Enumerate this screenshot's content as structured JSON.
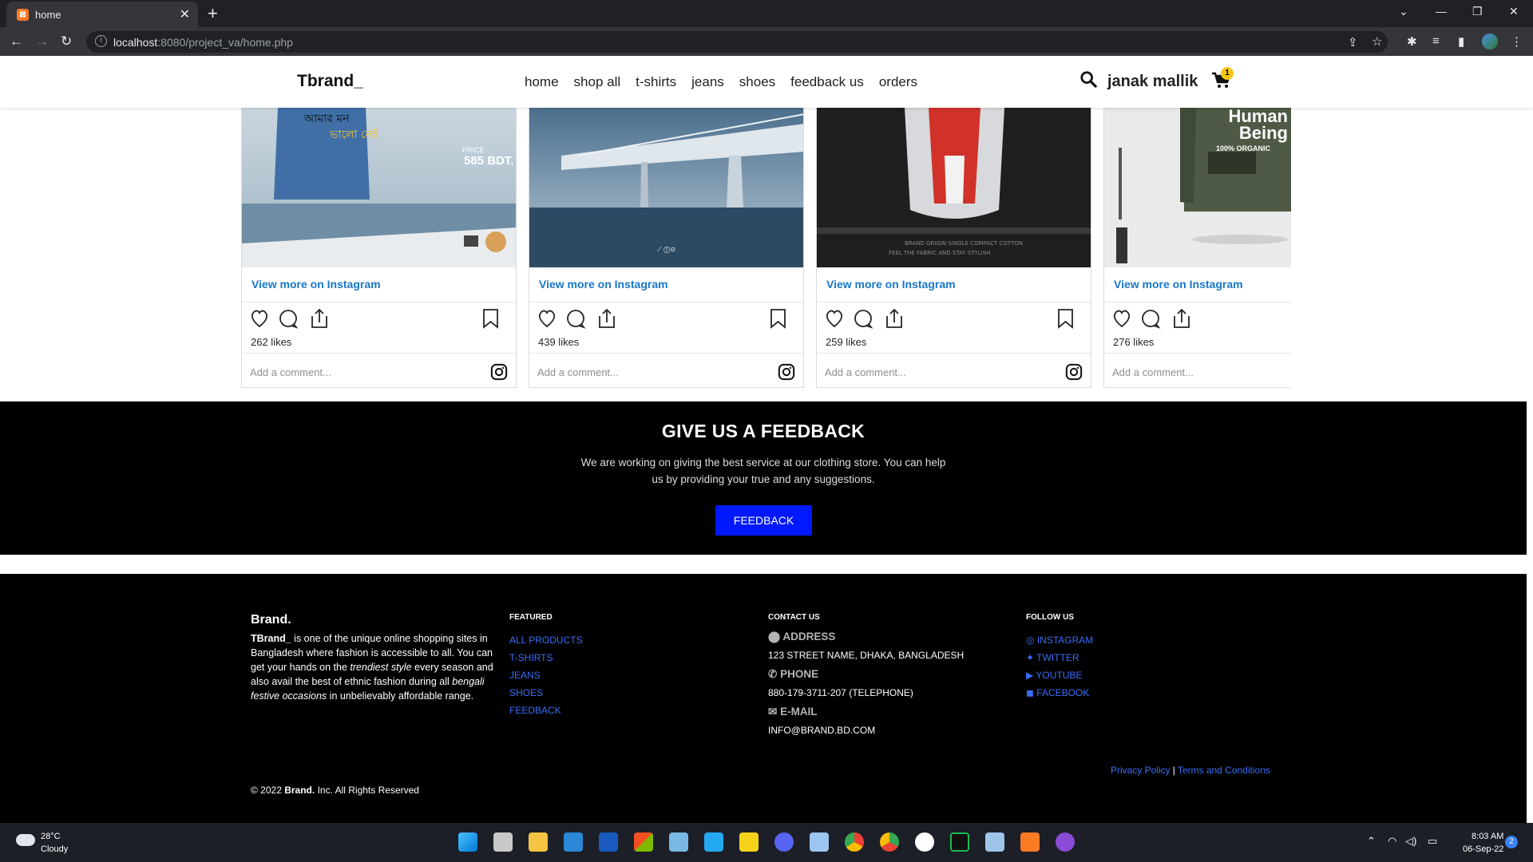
{
  "browser": {
    "tab_title": "home",
    "new_tab": "+",
    "url_host": "localhost",
    "url_rest": ":8080/project_va/home.php"
  },
  "site": {
    "brand": "Tbrand_",
    "nav": [
      "home",
      "shop all",
      "t-shirts",
      "jeans",
      "shoes",
      "feedback us",
      "orders"
    ],
    "user": "janak mallik",
    "cart_count": "1"
  },
  "instagram": {
    "link_label": "View more on Instagram",
    "comment_placeholder": "Add a comment...",
    "posts": [
      {
        "likes": "262 likes",
        "price_label": "PRICE",
        "price": "585 BDT."
      },
      {
        "likes": "439 likes"
      },
      {
        "likes": "259 likes"
      },
      {
        "likes": "276 likes",
        "headline": "Human Being",
        "organic": "100% ORGANIC"
      }
    ]
  },
  "feedback": {
    "title": "GIVE US A FEEDBACK",
    "text": "We are working on giving the best service at our clothing store. You can help us by providing your true and any suggestions.",
    "button": "FEEDBACK"
  },
  "footer": {
    "brand": "Brand.",
    "about_bold": "TBrand_",
    "about_1": " is one of the unique online shopping sites in Bangladesh where fashion is accessible to all. You can get your hands on the ",
    "about_italic1": "trendiest style",
    "about_2": " every season and also avail the best of ethnic fashion during all ",
    "about_italic2": "bengali festive occasions",
    "about_3": " in unbelievably affordable range.",
    "featured_title": "FEATURED",
    "featured": [
      "ALL PRODUCTS",
      "T-SHIRTS",
      "JEANS",
      "SHOES",
      "FEEDBACK"
    ],
    "contact_title": "CONTACT US",
    "address_label": "ADDRESS",
    "address": "123 STREET NAME, DHAKA, BANGLADESH",
    "phone_label": "PHONE",
    "phone": "880-179-3711-207 (TELEPHONE)",
    "email_label": "E-MAIL",
    "email": "INFO@BRAND.BD.COM",
    "follow_title": "FOLLOW US",
    "social": [
      "INSTAGRAM",
      "TWITTER",
      "YOUTUBE",
      "FACEBOOK"
    ],
    "privacy": "Privacy Policy",
    "terms": "Terms and Conditions",
    "copyright_pre": "© 2022 ",
    "copyright_brand": "Brand.",
    "copyright_post": " Inc. All Rights Reserved"
  },
  "taskbar": {
    "temp": "28°C",
    "condition": "Cloudy",
    "time": "8:03 AM",
    "date": "06-Sep-22",
    "notifications": "2"
  },
  "colors": {
    "accent_link": "#3b6df5",
    "feedback_button": "#0018ff",
    "instagram_link": "#1877c9",
    "cart_badge": "#f5c518"
  }
}
